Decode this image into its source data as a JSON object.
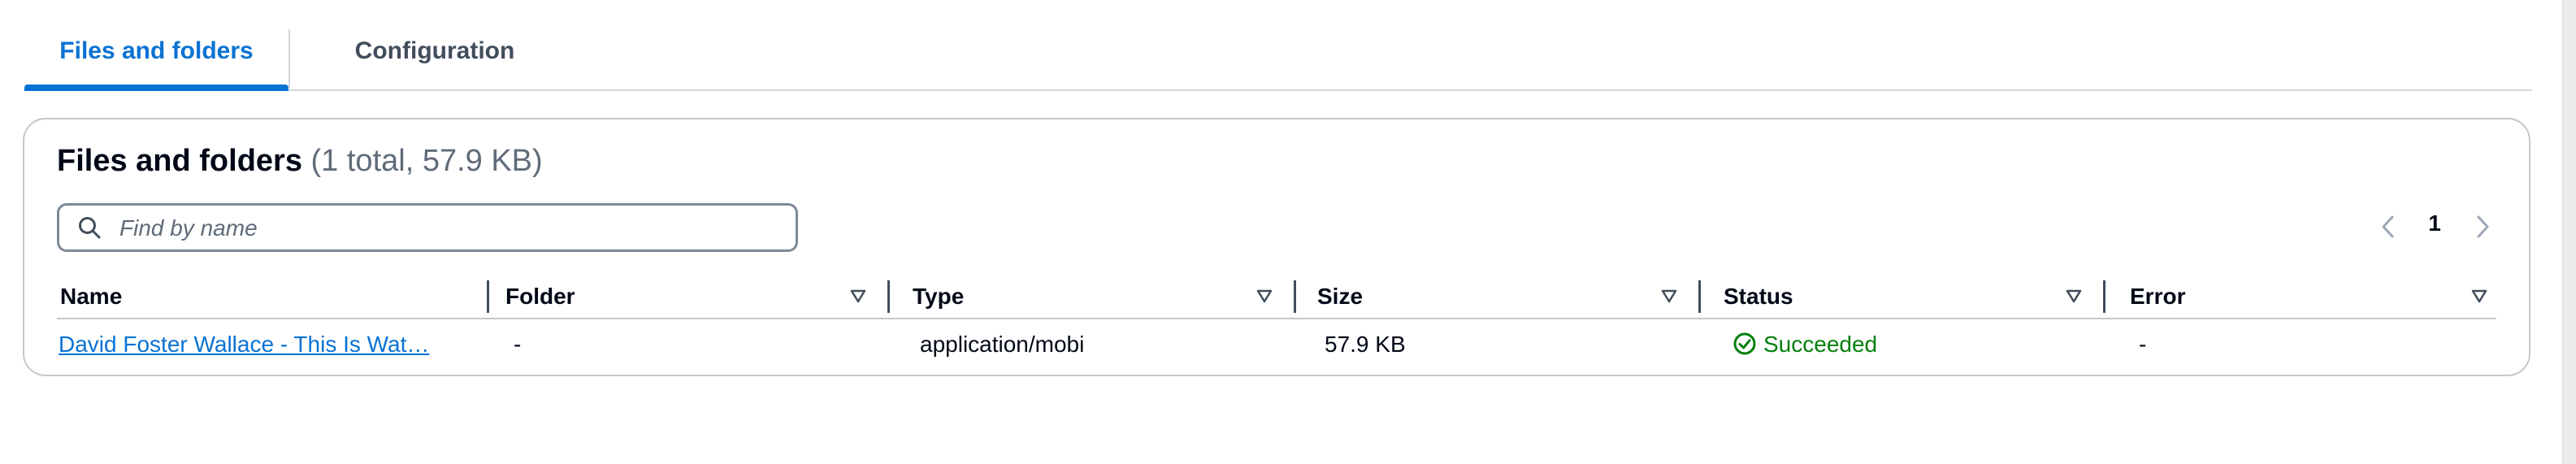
{
  "tabs": [
    {
      "label": "Files and folders",
      "active": true
    },
    {
      "label": "Configuration",
      "active": false
    }
  ],
  "panel": {
    "title": "Files and folders",
    "count": "(1 total, 57.9 KB)"
  },
  "search": {
    "placeholder": "Find by name",
    "value": ""
  },
  "pagination": {
    "current_page": "1"
  },
  "table": {
    "columns": [
      "Name",
      "Folder",
      "Type",
      "Size",
      "Status",
      "Error"
    ],
    "rows": [
      {
        "name": "David Foster Wallace - This Is Wat…",
        "folder": "-",
        "type": "application/mobi",
        "size": "57.9 KB",
        "status": "Succeeded",
        "error": "-"
      }
    ]
  },
  "colors": {
    "accent": "#0972d3",
    "success": "#037f0c",
    "text": "#000716",
    "muted": "#5f6b7a"
  },
  "icons": [
    "search-icon",
    "chevron-left-icon",
    "chevron-right-icon",
    "sort-triangle-icon",
    "check-circle-icon"
  ]
}
